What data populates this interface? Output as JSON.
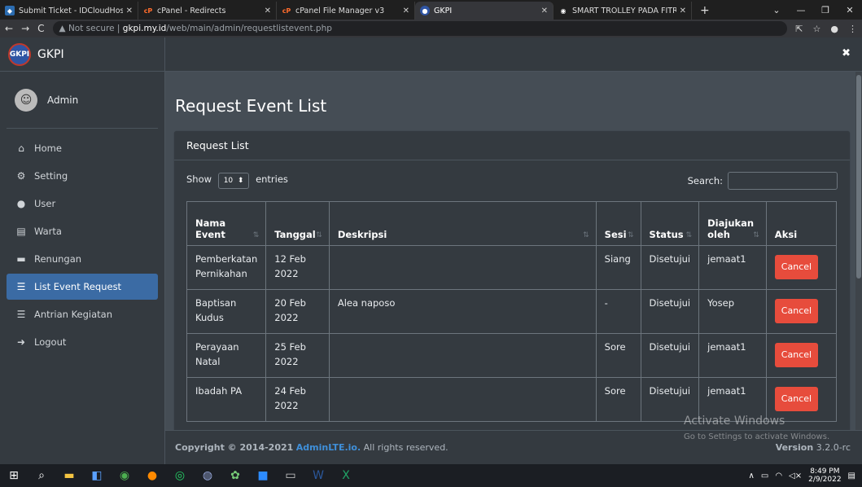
{
  "browser": {
    "tabs": [
      {
        "title": "Submit Ticket - IDCloudHost",
        "active": false,
        "icon": "idcloudhost-icon"
      },
      {
        "title": "cPanel - Redirects",
        "active": false,
        "icon": "cpanel-icon"
      },
      {
        "title": "cPanel File Manager v3",
        "active": false,
        "icon": "cpanel-icon"
      },
      {
        "title": "GKPI",
        "active": true,
        "icon": "gkpi-icon"
      },
      {
        "title": "SMART TROLLEY PADA FITRI",
        "active": false,
        "icon": "globe-icon"
      }
    ],
    "address": {
      "security": "Not secure",
      "domain": "gkpi.my.id",
      "path": "/web/main/admin/requestlistevent.php"
    }
  },
  "brand": {
    "name": "GKPI",
    "logo_text": "GKPI"
  },
  "user": {
    "name": "Admin"
  },
  "sidebar": {
    "items": [
      {
        "label": "Home",
        "icon": "home-icon",
        "glyph": "⌂",
        "active": false
      },
      {
        "label": "Setting",
        "icon": "cogs-icon",
        "glyph": "⚙",
        "active": false
      },
      {
        "label": "User",
        "icon": "user-icon",
        "glyph": "●",
        "active": false
      },
      {
        "label": "Warta",
        "icon": "newspaper-icon",
        "glyph": "▤",
        "active": false
      },
      {
        "label": "Renungan",
        "icon": "book-icon",
        "glyph": "▬",
        "active": false
      },
      {
        "label": "List Event Request",
        "icon": "list-icon",
        "glyph": "☰",
        "active": true
      },
      {
        "label": "Antrian Kegiatan",
        "icon": "list-icon",
        "glyph": "☰",
        "active": false
      },
      {
        "label": "Logout",
        "icon": "logout-icon",
        "glyph": "➜",
        "active": false
      }
    ]
  },
  "page": {
    "title": "Request Event List"
  },
  "card": {
    "title": "Request List"
  },
  "controls": {
    "show": "Show",
    "length": "10",
    "entries": "entries",
    "search": "Search:"
  },
  "table": {
    "headers": [
      "Nama Event",
      "Tanggal",
      "Deskripsi",
      "Sesi",
      "Status",
      "Diajukan oleh",
      "Aksi"
    ],
    "rows": [
      {
        "nama": "Pemberkatan Pernikahan",
        "tanggal": "12 Feb 2022",
        "deskripsi": "",
        "sesi": "Siang",
        "status": "Disetujui",
        "oleh": "jemaat1",
        "aksi": "Cancel"
      },
      {
        "nama": "Baptisan Kudus",
        "tanggal": "20 Feb 2022",
        "deskripsi": "Alea naposo",
        "sesi": "-",
        "status": "Disetujui",
        "oleh": "Yosep",
        "aksi": "Cancel"
      },
      {
        "nama": "Perayaan Natal",
        "tanggal": "25 Feb 2022",
        "deskripsi": "",
        "sesi": "Sore",
        "status": "Disetujui",
        "oleh": "jemaat1",
        "aksi": "Cancel"
      },
      {
        "nama": "Ibadah PA",
        "tanggal": "24 Feb 2022",
        "deskripsi": "",
        "sesi": "Sore",
        "status": "Disetujui",
        "oleh": "jemaat1",
        "aksi": "Cancel"
      }
    ]
  },
  "footer": {
    "copyright": "Copyright © 2014-2021",
    "link": "AdminLTE.io.",
    "rights": "All rights reserved.",
    "version_label": "Version",
    "version": "3.2.0-rc"
  },
  "watermark": {
    "title": "Activate Windows",
    "subtitle": "Go to Settings to activate Windows."
  },
  "taskbar": {
    "time": "8:49 PM",
    "date": "2/9/2022"
  },
  "colors": {
    "accent": "#3b6ba4",
    "danger": "#e74c3c",
    "bg": "#343a40",
    "content": "#454d55"
  }
}
